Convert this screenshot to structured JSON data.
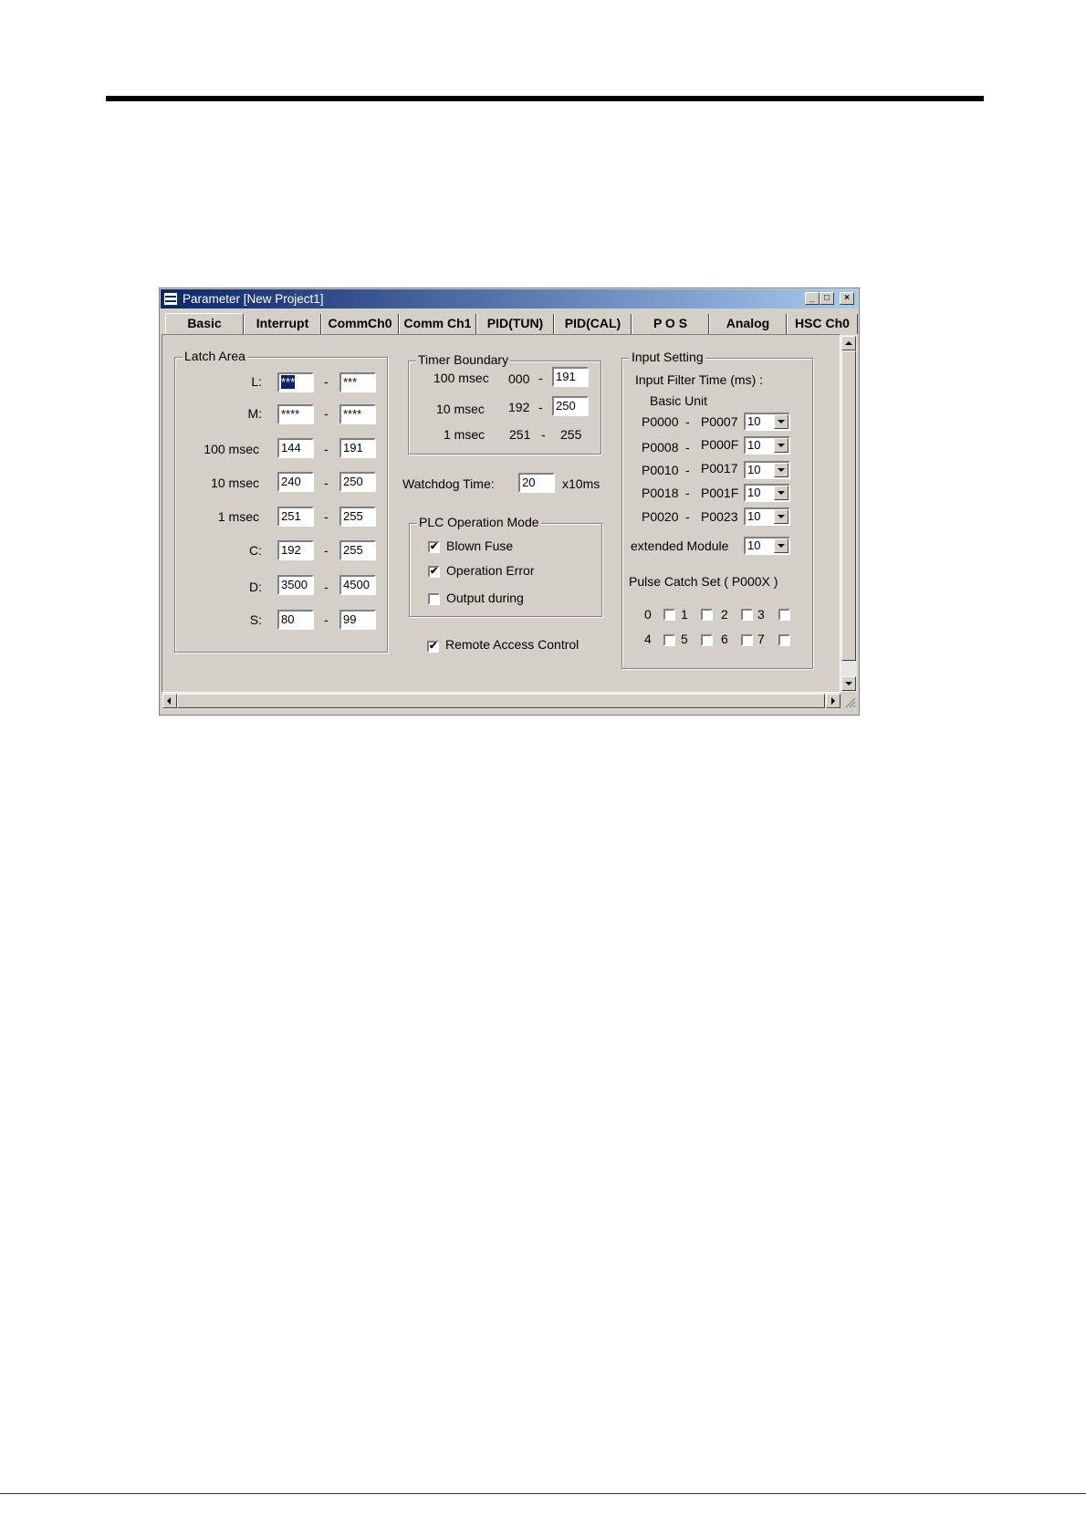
{
  "window": {
    "title": "Parameter [New Project1]",
    "minimize_label": "_",
    "maximize_label": "□",
    "close_label": "×"
  },
  "tabs": [
    {
      "label": "Basic",
      "active": true
    },
    {
      "label": "Interrupt"
    },
    {
      "label": "CommCh0"
    },
    {
      "label": "Comm Ch1"
    },
    {
      "label": "PID(TUN)"
    },
    {
      "label": "PID(CAL)"
    },
    {
      "label": "P O S"
    },
    {
      "label": "Analog"
    },
    {
      "label": "HSC Ch0"
    }
  ],
  "latch_area": {
    "title": "Latch Area",
    "rows": [
      {
        "label": "L:",
        "from": "***",
        "to": "***"
      },
      {
        "label": "M:",
        "from": "****",
        "to": "****"
      },
      {
        "label": "100 msec",
        "from": "144",
        "to": "191"
      },
      {
        "label": "10 msec",
        "from": "240",
        "to": "250"
      },
      {
        "label": "1 msec",
        "from": "251",
        "to": "255"
      },
      {
        "label": "C:",
        "from": "192",
        "to": "255"
      },
      {
        "label": "D:",
        "from": "3500",
        "to": "4500"
      },
      {
        "label": "S:",
        "from": "80",
        "to": "99"
      }
    ]
  },
  "dash": "-",
  "timer_boundary": {
    "title": "Timer Boundary",
    "rows": [
      {
        "label": "100 msec",
        "start": "000",
        "end": "191"
      },
      {
        "label": "10 msec",
        "start": "192",
        "end": "250"
      },
      {
        "label": "1 msec",
        "start": "251",
        "end": "255"
      }
    ]
  },
  "watchdog": {
    "label": "Watchdog Time:",
    "value": "20",
    "unit": "x10ms"
  },
  "plc_operation_mode": {
    "title": "PLC Operation Mode",
    "options": [
      {
        "label": "Blown Fuse",
        "checked": true
      },
      {
        "label": "Operation Error",
        "checked": true
      },
      {
        "label": "Output during",
        "checked": false
      }
    ]
  },
  "remote_access": {
    "label": "Remote Access Control",
    "checked": true
  },
  "check_mark": "✔",
  "input_setting": {
    "title": "Input Setting",
    "filter_label": "Input Filter Time (ms) :",
    "basic_unit_label": "Basic Unit",
    "ranges": [
      {
        "from": "P0000",
        "to": "P0007",
        "value": "10"
      },
      {
        "from": "P0008",
        "to": "P000F",
        "value": "10"
      },
      {
        "from": "P0010",
        "to": "P0017",
        "value": "10"
      },
      {
        "from": "P0018",
        "to": "P001F",
        "value": "10"
      },
      {
        "from": "P0020",
        "to": "P0023",
        "value": "10"
      }
    ],
    "extended_label": "extended Module",
    "extended_value": "10",
    "pulse_catch_label": "Pulse Catch Set ( P000X )",
    "pulse_bits": [
      "0",
      "1",
      "2",
      "3",
      "4",
      "5",
      "6",
      "7"
    ]
  }
}
